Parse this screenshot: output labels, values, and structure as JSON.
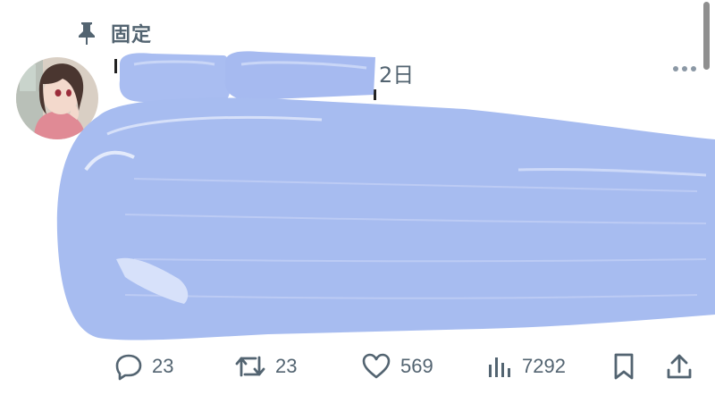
{
  "pinned": {
    "label": "固定",
    "icon": "pin-icon"
  },
  "post": {
    "date_fragment": "2日",
    "avatar_icon": "avatar",
    "more_icon": "more-dots-icon",
    "content_redacted": true,
    "redaction_color": "#a9bdf1"
  },
  "actions": {
    "reply": {
      "icon": "reply-icon",
      "count": "23"
    },
    "repost": {
      "icon": "repost-icon",
      "count": "23"
    },
    "like": {
      "icon": "heart-icon",
      "count": "569"
    },
    "views": {
      "icon": "views-chart-icon",
      "count": "7292"
    },
    "bookmark": {
      "icon": "bookmark-icon"
    },
    "share": {
      "icon": "share-icon"
    }
  },
  "colors": {
    "text_secondary": "#536471",
    "redaction": "#a9bdf1"
  }
}
